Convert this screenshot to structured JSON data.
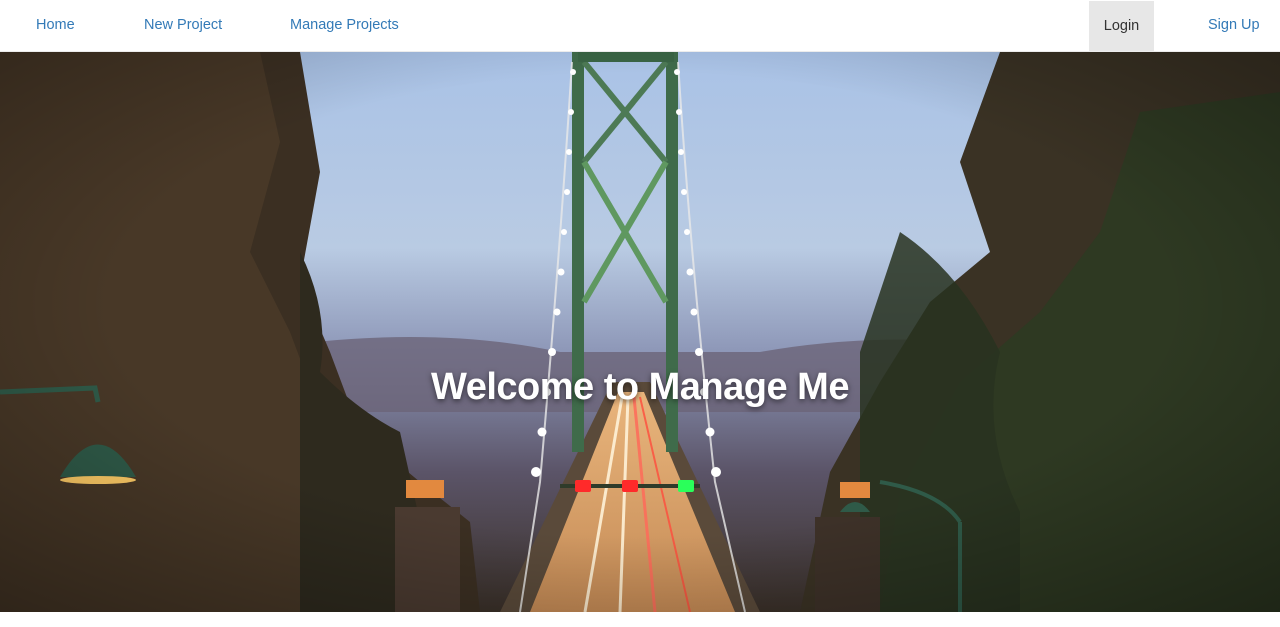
{
  "nav": {
    "home": "Home",
    "new_project": "New Project",
    "manage_projects": "Manage Projects",
    "login": "Login",
    "signup": "Sign Up"
  },
  "hero": {
    "title": "Welcome to Manage Me",
    "image": "photo of illuminated suspension bridge at dusk framed by trees"
  },
  "colors": {
    "link": "#337ab7",
    "active_bg": "#e7e7e7",
    "hero_text": "#ffffff"
  }
}
